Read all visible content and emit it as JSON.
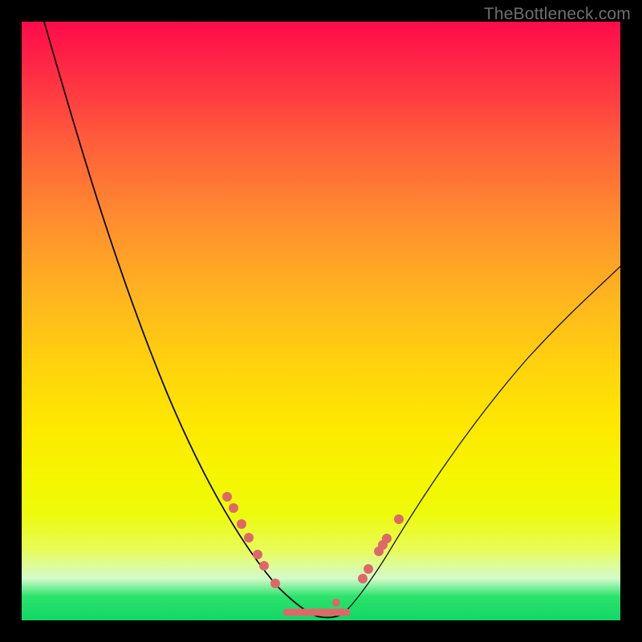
{
  "watermark_text": "TheBottleneck.com",
  "colors": {
    "bead": "#de6868",
    "curve": "#000000",
    "frame": "#000000"
  },
  "chart_data": {
    "type": "line",
    "title": "",
    "xlabel": "",
    "ylabel": "",
    "xlim": [
      0,
      100
    ],
    "ylim": [
      0,
      100
    ],
    "series": [
      {
        "name": "left-lobe",
        "x": [
          4,
          8,
          12,
          16,
          20,
          24,
          28,
          32,
          36,
          40,
          44,
          46,
          48
        ],
        "y": [
          100,
          90,
          79,
          68,
          57,
          46,
          36,
          26,
          18,
          11,
          5,
          3,
          1
        ]
      },
      {
        "name": "right-lobe",
        "x": [
          52,
          54,
          58,
          62,
          66,
          72,
          78,
          84,
          90,
          96,
          100
        ],
        "y": [
          1,
          3,
          8,
          14,
          21,
          30,
          38,
          45,
          51,
          56,
          60
        ]
      },
      {
        "name": "valley-floor",
        "x": [
          44,
          46,
          48,
          50,
          52,
          54
        ],
        "y": [
          5,
          3,
          1,
          1,
          1,
          3
        ]
      }
    ],
    "markers": {
      "left_beads": [
        {
          "x": 34,
          "y": 21
        },
        {
          "x": 35,
          "y": 19
        },
        {
          "x": 37,
          "y": 16
        },
        {
          "x": 38,
          "y": 14
        },
        {
          "x": 40,
          "y": 11
        },
        {
          "x": 41,
          "y": 9
        },
        {
          "x": 43,
          "y": 6
        }
      ],
      "right_beads": [
        {
          "x": 57,
          "y": 7
        },
        {
          "x": 58,
          "y": 9
        },
        {
          "x": 60,
          "y": 12
        },
        {
          "x": 60.5,
          "y": 13
        },
        {
          "x": 61,
          "y": 14
        },
        {
          "x": 63,
          "y": 17
        }
      ],
      "bottom_segment": {
        "x0": 44,
        "x1": 54,
        "y": 1.5
      }
    }
  }
}
